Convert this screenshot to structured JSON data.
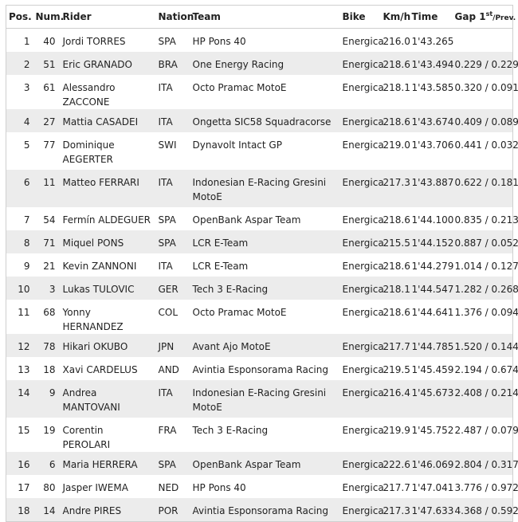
{
  "headers": {
    "pos": "Pos.",
    "num": "Num.",
    "rider": "Rider",
    "nation": "Nation",
    "team": "Team",
    "bike": "Bike",
    "kmh": "Km/h",
    "time": "Time",
    "gap": "Gap 1",
    "gap_sup": "st",
    "gap_suffix": "/Prev."
  },
  "rows": [
    {
      "pos": "1",
      "num": "40",
      "rider": "Jordi TORRES",
      "nation": "SPA",
      "team": "HP Pons 40",
      "bike": "Energica",
      "kmh": "216.0",
      "time": "1'43.265",
      "gap": ""
    },
    {
      "pos": "2",
      "num": "51",
      "rider": "Eric GRANADO",
      "nation": "BRA",
      "team": "One Energy Racing",
      "bike": "Energica",
      "kmh": "218.6",
      "time": "1'43.494",
      "gap": "0.229 / 0.229"
    },
    {
      "pos": "3",
      "num": "61",
      "rider": "Alessandro ZACCONE",
      "nation": "ITA",
      "team": "Octo Pramac MotoE",
      "bike": "Energica",
      "kmh": "218.1",
      "time": "1'43.585",
      "gap": "0.320 / 0.091"
    },
    {
      "pos": "4",
      "num": "27",
      "rider": "Mattia CASADEI",
      "nation": "ITA",
      "team": "Ongetta SIC58 Squadracorse",
      "bike": "Energica",
      "kmh": "218.6",
      "time": "1'43.674",
      "gap": "0.409 / 0.089"
    },
    {
      "pos": "5",
      "num": "77",
      "rider": "Dominique AEGERTER",
      "nation": "SWI",
      "team": "Dynavolt Intact GP",
      "bike": "Energica",
      "kmh": "219.0",
      "time": "1'43.706",
      "gap": "0.441 / 0.032"
    },
    {
      "pos": "6",
      "num": "11",
      "rider": "Matteo FERRARI",
      "nation": "ITA",
      "team": "Indonesian E-Racing Gresini MotoE",
      "bike": "Energica",
      "kmh": "217.3",
      "time": "1'43.887",
      "gap": "0.622 / 0.181"
    },
    {
      "pos": "7",
      "num": "54",
      "rider": "Fermín ALDEGUER",
      "nation": "SPA",
      "team": "OpenBank Aspar Team",
      "bike": "Energica",
      "kmh": "218.6",
      "time": "1'44.100",
      "gap": "0.835 / 0.213"
    },
    {
      "pos": "8",
      "num": "71",
      "rider": "Miquel PONS",
      "nation": "SPA",
      "team": "LCR E-Team",
      "bike": "Energica",
      "kmh": "215.5",
      "time": "1'44.152",
      "gap": "0.887 / 0.052"
    },
    {
      "pos": "9",
      "num": "21",
      "rider": "Kevin ZANNONI",
      "nation": "ITA",
      "team": "LCR E-Team",
      "bike": "Energica",
      "kmh": "218.6",
      "time": "1'44.279",
      "gap": "1.014 / 0.127"
    },
    {
      "pos": "10",
      "num": "3",
      "rider": "Lukas TULOVIC",
      "nation": "GER",
      "team": "Tech 3 E-Racing",
      "bike": "Energica",
      "kmh": "218.1",
      "time": "1'44.547",
      "gap": "1.282 / 0.268"
    },
    {
      "pos": "11",
      "num": "68",
      "rider": "Yonny HERNANDEZ",
      "nation": "COL",
      "team": "Octo Pramac MotoE",
      "bike": "Energica",
      "kmh": "218.6",
      "time": "1'44.641",
      "gap": "1.376 / 0.094"
    },
    {
      "pos": "12",
      "num": "78",
      "rider": "Hikari OKUBO",
      "nation": "JPN",
      "team": "Avant Ajo MotoE",
      "bike": "Energica",
      "kmh": "217.7",
      "time": "1'44.785",
      "gap": "1.520 / 0.144"
    },
    {
      "pos": "13",
      "num": "18",
      "rider": "Xavi CARDELUS",
      "nation": "AND",
      "team": "Avintia Esponsorama Racing",
      "bike": "Energica",
      "kmh": "219.5",
      "time": "1'45.459",
      "gap": "2.194 / 0.674"
    },
    {
      "pos": "14",
      "num": "9",
      "rider": "Andrea MANTOVANI",
      "nation": "ITA",
      "team": "Indonesian E-Racing Gresini MotoE",
      "bike": "Energica",
      "kmh": "216.4",
      "time": "1'45.673",
      "gap": "2.408 / 0.214"
    },
    {
      "pos": "15",
      "num": "19",
      "rider": "Corentin PEROLARI",
      "nation": "FRA",
      "team": "Tech 3 E-Racing",
      "bike": "Energica",
      "kmh": "219.9",
      "time": "1'45.752",
      "gap": "2.487 / 0.079"
    },
    {
      "pos": "16",
      "num": "6",
      "rider": "Maria HERRERA",
      "nation": "SPA",
      "team": "OpenBank Aspar Team",
      "bike": "Energica",
      "kmh": "222.6",
      "time": "1'46.069",
      "gap": "2.804 / 0.317"
    },
    {
      "pos": "17",
      "num": "80",
      "rider": "Jasper IWEMA",
      "nation": "NED",
      "team": "HP Pons 40",
      "bike": "Energica",
      "kmh": "217.7",
      "time": "1'47.041",
      "gap": "3.776 / 0.972"
    },
    {
      "pos": "18",
      "num": "14",
      "rider": "Andre PIRES",
      "nation": "POR",
      "team": "Avintia Esponsorama Racing",
      "bike": "Energica",
      "kmh": "217.3",
      "time": "1'47.633",
      "gap": "4.368 / 0.592"
    }
  ]
}
